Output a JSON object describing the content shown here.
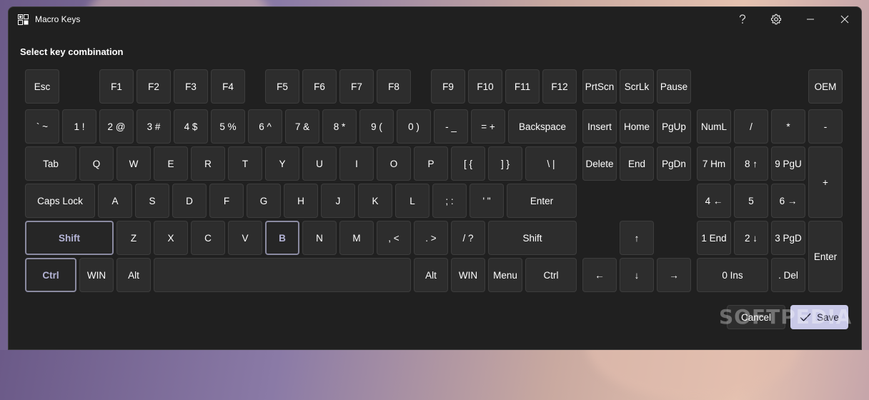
{
  "window": {
    "title": "Macro Keys",
    "heading": "Select key combination"
  },
  "titlebar_icons": [
    "help-icon",
    "settings-icon",
    "minimize-icon",
    "close-icon"
  ],
  "colors": {
    "window_bg": "#202020",
    "key_bg": "#2d2d2d",
    "key_border": "#3d3d3d",
    "selected_border": "#8a8aa0",
    "selected_text": "#b4b4d6",
    "accent": "#c9c9e8"
  },
  "keys": {
    "esc": "Esc",
    "f1": "F1",
    "f2": "F2",
    "f3": "F3",
    "f4": "F4",
    "f5": "F5",
    "f6": "F6",
    "f7": "F7",
    "f8": "F8",
    "f9": "F9",
    "f10": "F10",
    "f11": "F11",
    "f12": "F12",
    "prtscn": "PrtScn",
    "scrlk": "ScrLk",
    "pause": "Pause",
    "oem": "OEM",
    "backtick": "` ~",
    "n1": "1 !",
    "n2": "2 @",
    "n3": "3 #",
    "n4": "4 $",
    "n5": "5 %",
    "n6": "6 ^",
    "n7": "7 &",
    "n8": "8 *",
    "n9": "9 (",
    "n0": "0 )",
    "minus": "- _",
    "equals": "= +",
    "backspace": "Backspace",
    "insert": "Insert",
    "home": "Home",
    "pgup": "PgUp",
    "numlock": "NumL",
    "num_div": "/",
    "num_mul": "*",
    "num_sub": "-",
    "tab": "Tab",
    "q": "Q",
    "w": "W",
    "e": "E",
    "r": "R",
    "t": "T",
    "y": "Y",
    "u": "U",
    "i": "I",
    "o": "O",
    "p": "P",
    "lbracket": "[ {",
    "rbracket": "] }",
    "backslash": "\\ |",
    "delete": "Delete",
    "end": "End",
    "pgdn": "PgDn",
    "num7": "7 Hm",
    "num8": "8 ↑",
    "num9": "9 PgU",
    "num_add": "+",
    "capslock": "Caps Lock",
    "a": "A",
    "s": "S",
    "d": "D",
    "f": "F",
    "g": "G",
    "h": "H",
    "j": "J",
    "k": "K",
    "l": "L",
    "semicolon": "; :",
    "quote": "' \"",
    "enter": "Enter",
    "num4": "4 ←",
    "num5": "5",
    "num6": "6 →",
    "lshift": "Shift",
    "z": "Z",
    "x": "X",
    "c": "C",
    "v": "V",
    "b": "B",
    "n": "N",
    "m": "M",
    "comma": ", <",
    "period": ". >",
    "slash": "/ ?",
    "rshift": "Shift",
    "arrow_up": "↑",
    "num1": "1 End",
    "num2": "2 ↓",
    "num3": "3 PgD",
    "num_enter": "Enter",
    "lctrl": "Ctrl",
    "lwin": "WIN",
    "lalt": "Alt",
    "space": "",
    "ralt": "Alt",
    "rwin": "WIN",
    "menu": "Menu",
    "rctrl": "Ctrl",
    "arrow_left": "←",
    "arrow_down": "↓",
    "arrow_right": "→",
    "num0": "0 Ins",
    "num_dec": ". Del"
  },
  "selected_keys": [
    "Shift",
    "B",
    "Ctrl"
  ],
  "footer": {
    "cancel_label": "Cancel",
    "save_label": "Save"
  },
  "watermark": "SOFTPEDIA"
}
